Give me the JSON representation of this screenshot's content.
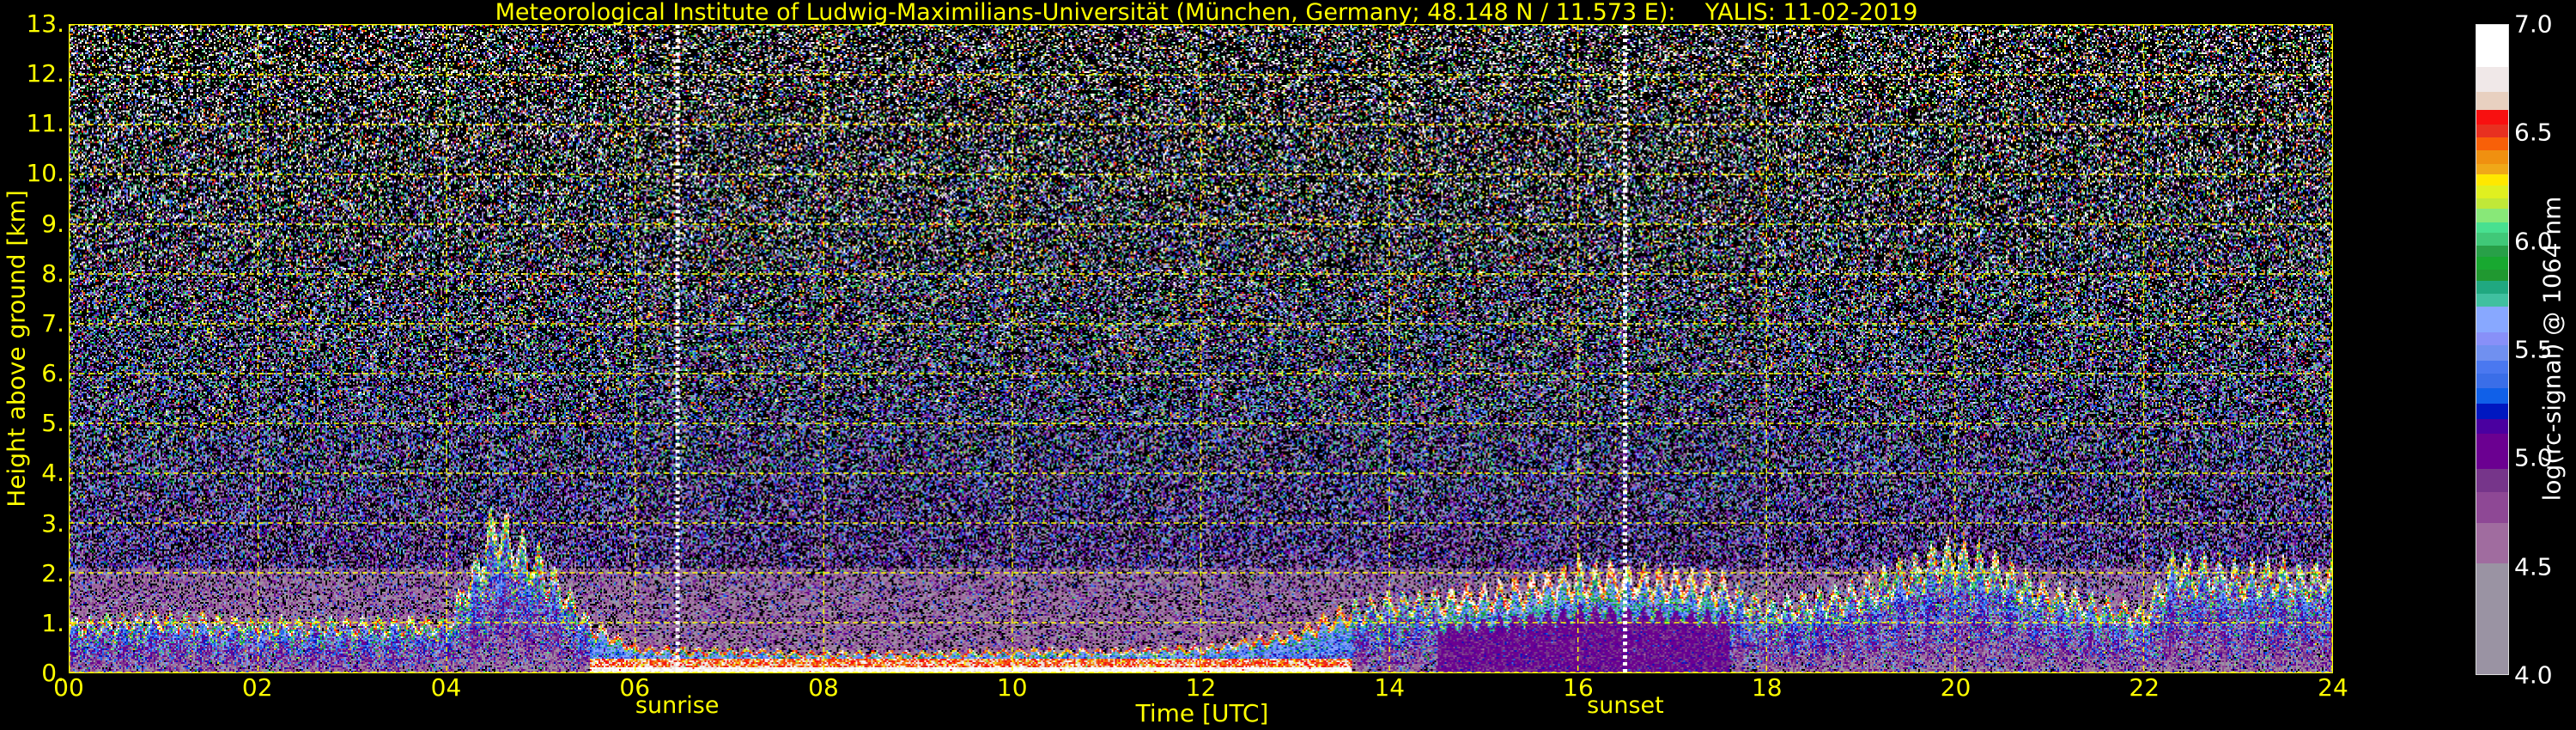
{
  "title": "Meteorological Institute of Ludwig-Maximilians-Universität (München, Germany; 48.148 N / 11.573 E):    YALIS: 11-02-2019",
  "chart_data": {
    "type": "heatmap",
    "title": "Meteorological Institute of Ludwig-Maximilians-Universität (München, Germany; 48.148 N / 11.573 E):    YALIS: 11-02-2019",
    "xlabel": "Time [UTC]",
    "ylabel": "Height above ground [km]",
    "xlim": [
      0,
      24
    ],
    "ylim": [
      0,
      13
    ],
    "x_ticks": [
      0,
      2,
      4,
      6,
      8,
      10,
      12,
      14,
      16,
      18,
      20,
      22,
      24
    ],
    "x_tick_labels": [
      "00",
      "02",
      "04",
      "06",
      "08",
      "10",
      "12",
      "14",
      "16",
      "18",
      "20",
      "22",
      "24"
    ],
    "y_ticks": [
      0,
      1,
      2,
      3,
      4,
      5,
      6,
      7,
      8,
      9,
      10,
      11,
      12,
      13
    ],
    "y_tick_labels": [
      "0.",
      "1.",
      "2.",
      "3.",
      "4.",
      "5.",
      "6.",
      "7.",
      "8.",
      "9.",
      "10.",
      "11.",
      "12.",
      "13."
    ],
    "grid": true,
    "annotations": [
      {
        "label": "sunrise",
        "time_utc": 6.45
      },
      {
        "label": "sunset",
        "time_utc": 16.5
      }
    ],
    "colorbar": {
      "label": "log(rc-signal) @ 1064 nm",
      "range": [
        4.0,
        7.0
      ],
      "tick_labels": [
        "4.0",
        "4.5",
        "5.0",
        "5.5",
        "6.0",
        "6.5",
        "7.0"
      ],
      "ticks": [
        4.0,
        4.5,
        5.0,
        5.5,
        6.0,
        6.5,
        7.0
      ],
      "bounds": [
        4.0,
        4.51,
        4.7,
        4.84,
        4.95,
        5.11,
        5.18,
        5.25,
        5.32,
        5.39,
        5.45,
        5.52,
        5.58,
        5.7,
        5.76,
        5.82,
        5.87,
        5.93,
        5.98,
        6.04,
        6.09,
        6.15,
        6.2,
        6.26,
        6.31,
        6.36,
        6.42,
        6.48,
        6.54,
        6.61,
        6.69,
        6.805,
        7.0
      ],
      "colors": [
        "#9a93a3",
        "#a06c9f",
        "#8e4895",
        "#76358a",
        "#6b0091",
        "#4a00a0",
        "#0018c0",
        "#1060e8",
        "#3a6ee8",
        "#4a78f0",
        "#7090f0",
        "#8890f8",
        "#88a8ff",
        "#40c0a0",
        "#20a880",
        "#209830",
        "#18a830",
        "#28a048",
        "#40c878",
        "#48e090",
        "#88e878",
        "#c0e838",
        "#e0f020",
        "#ffe800",
        "#f0a818",
        "#f09010",
        "#f86008",
        "#e83020",
        "#f81010",
        "#e8d0c0",
        "#f0e8e8",
        "#ffffff"
      ]
    },
    "aerosol_layer_top_km": {
      "time_utc": [
        0,
        1,
        2,
        3,
        4,
        4.5,
        5,
        5.5,
        6,
        7,
        8,
        9,
        10,
        11,
        12,
        13,
        13.5,
        14,
        15,
        16,
        17,
        17.5,
        18,
        19,
        20,
        21,
        22,
        22.3,
        23,
        24
      ],
      "height_km": [
        1.0,
        1.1,
        1.0,
        1.0,
        1.0,
        3.0,
        2.2,
        1.0,
        0.5,
        0.45,
        0.4,
        0.4,
        0.45,
        0.45,
        0.5,
        0.8,
        1.2,
        1.45,
        1.6,
        2.0,
        1.9,
        1.8,
        1.3,
        1.7,
        2.5,
        1.6,
        1.2,
        2.2,
        2.0,
        2.0
      ]
    }
  },
  "colors": {
    "axis_text": "#ffff00",
    "grid": "#ffff00",
    "background": "#000000",
    "sun_line": "#ffffff"
  }
}
